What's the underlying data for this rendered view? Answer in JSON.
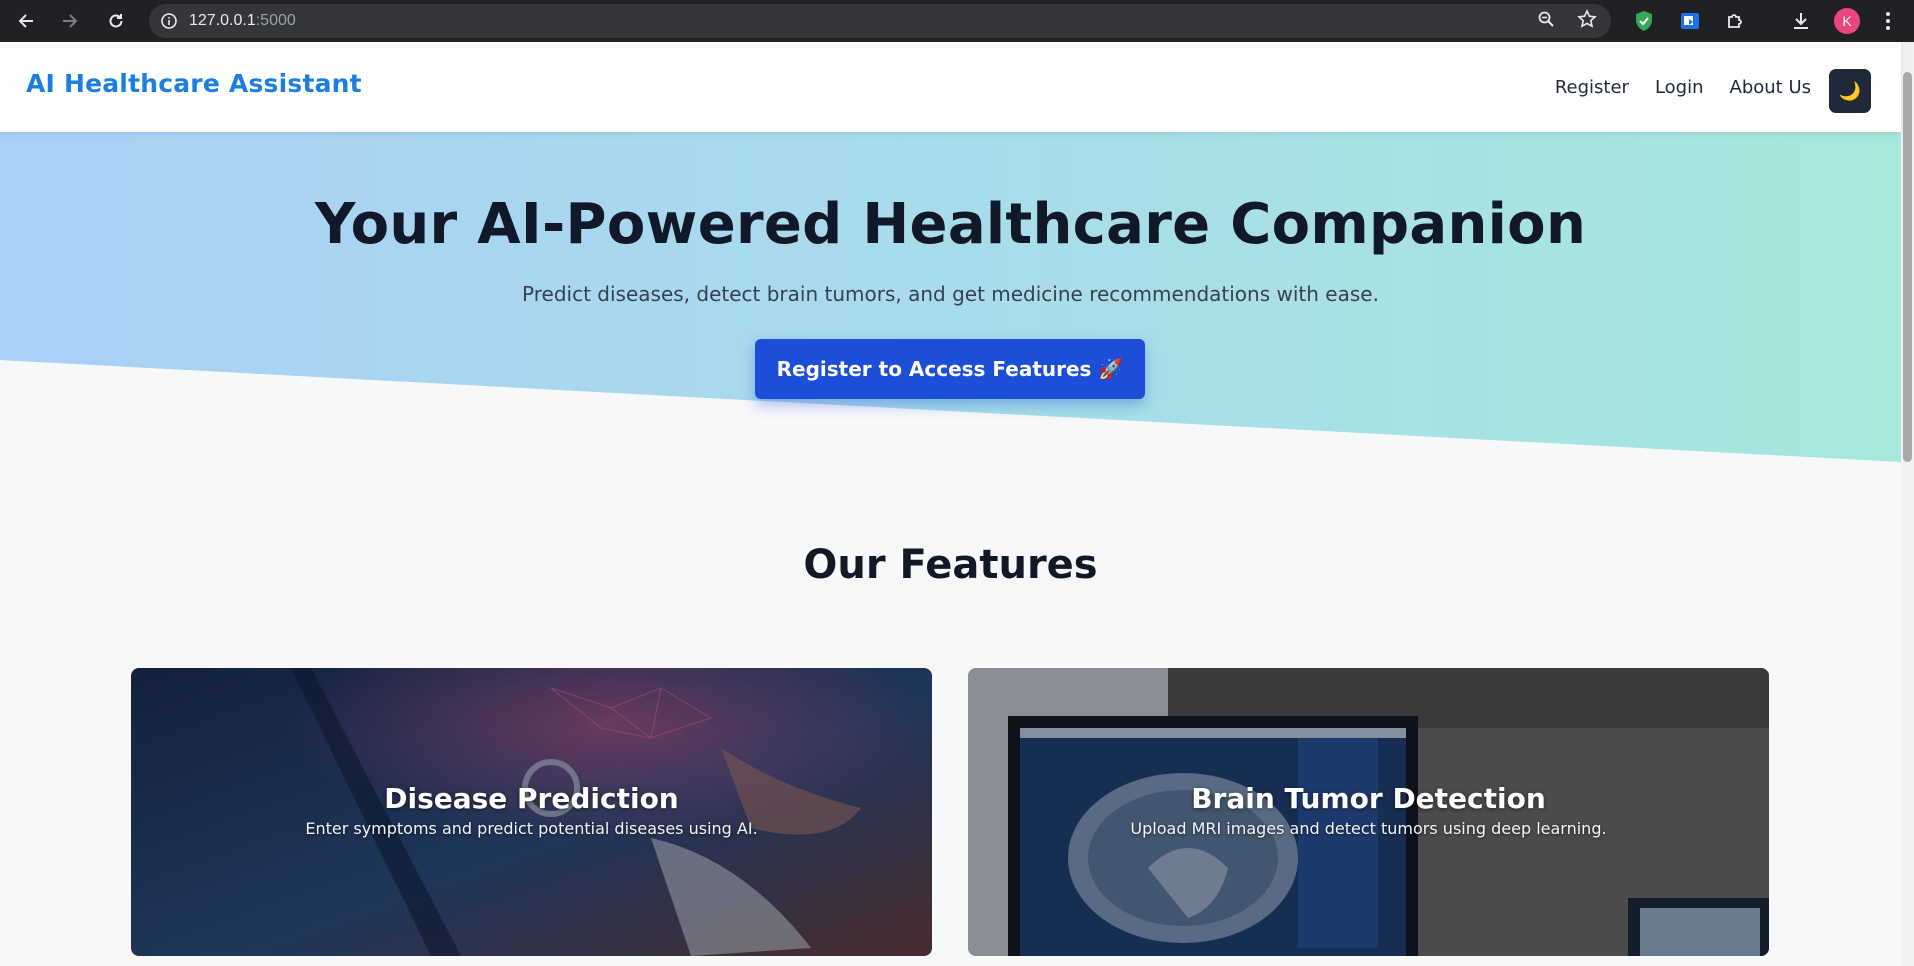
{
  "browser": {
    "url_host": "127.0.0.1",
    "url_port": ":5000",
    "profile_initial": "K",
    "icons": [
      "back-icon",
      "forward-icon",
      "reload-icon",
      "site-info-icon",
      "zoom-icon",
      "bookmark-star-icon",
      "shield-extension-icon",
      "screen-extension-icon",
      "puzzle-extensions-icon",
      "download-icon",
      "kebab-menu-icon"
    ]
  },
  "navbar": {
    "brand": "AI Healthcare Assistant",
    "links": [
      "Register",
      "Login",
      "About Us"
    ],
    "theme_toggle_icon": "🌙"
  },
  "hero": {
    "title": "Your AI-Powered Healthcare Companion",
    "subtitle": "Predict diseases, detect brain tumors, and get medicine recommendations with ease.",
    "cta": "Register to Access Features 🚀"
  },
  "features": {
    "heading": "Our Features",
    "cards": [
      {
        "title": "Disease Prediction",
        "description": "Enter symptoms and predict potential diseases using AI."
      },
      {
        "title": "Brain Tumor Detection",
        "description": "Upload MRI images and detect tumors using deep learning."
      }
    ]
  },
  "colors": {
    "brand": "#1a7fe0",
    "cta": "#1d4ed8",
    "hero_gradient_start": "#a9d0f7",
    "hero_gradient_end": "#a7e8dd",
    "dark": "#1f2937"
  }
}
